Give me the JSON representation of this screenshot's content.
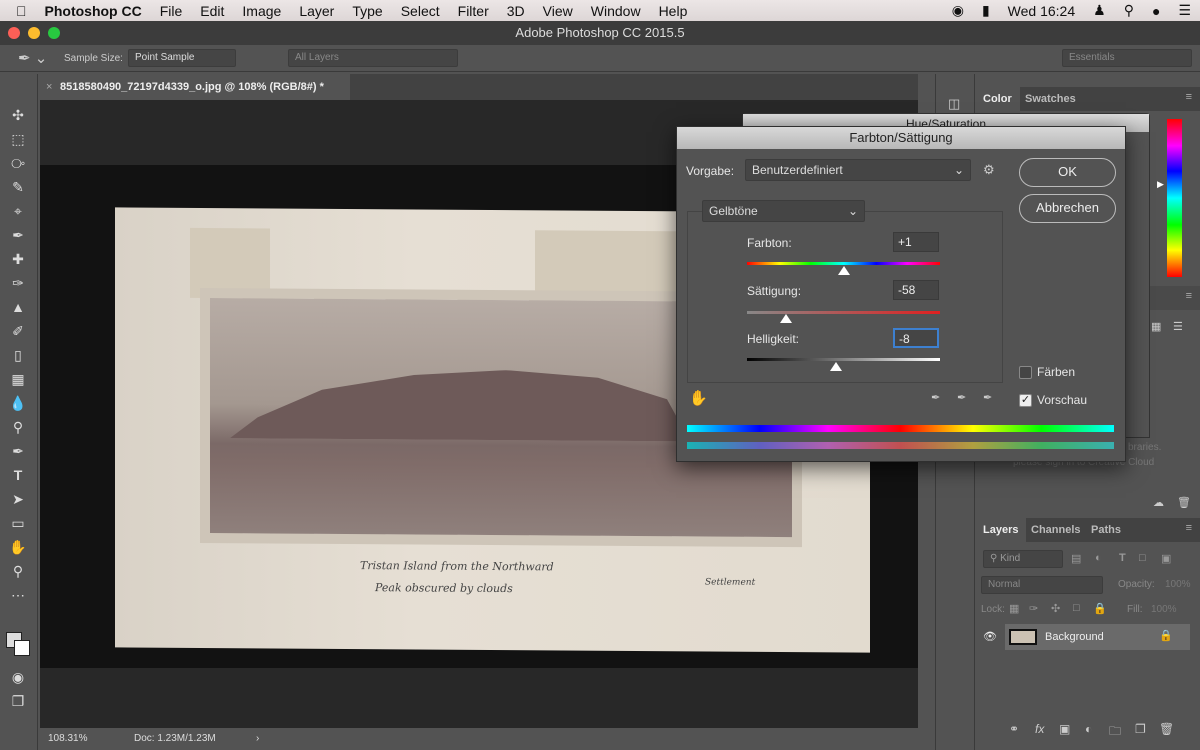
{
  "menubar": {
    "app": "Photoshop CC",
    "items": [
      "File",
      "Edit",
      "Image",
      "Layer",
      "Type",
      "Select",
      "Filter",
      "3D",
      "View",
      "Window",
      "Help"
    ],
    "clock": "Wed 16:24"
  },
  "window": {
    "title": "Adobe Photoshop CC 2015.5"
  },
  "options": {
    "sample_size_label": "Sample Size:",
    "sample_size_value": "Point Sample",
    "layers_value": "All Layers",
    "workspace": "Essentials"
  },
  "document": {
    "tab": "8518580490_72197d4339_o.jpg @ 108% (RGB/8#) *",
    "caption_line1": "Tristan Island from the Northward",
    "caption_line2": "Peak obscured by clouds",
    "caption_right": "Settlement"
  },
  "status": {
    "zoom": "108.31%",
    "doc": "Doc: 1.23M/1.23M"
  },
  "panels": {
    "color_tabs": [
      "Color",
      "Swatches"
    ],
    "libraries_text1": "braries.",
    "libraries_text2": "please sign in to Creative Cloud",
    "layers_tabs": [
      "Layers",
      "Channels",
      "Paths"
    ],
    "kind": "Kind",
    "blend": "Normal",
    "opacity_label": "Opacity:",
    "opacity": "100%",
    "lock_label": "Lock:",
    "fill_label": "Fill:",
    "fill": "100%",
    "layer_name": "Background"
  },
  "dialog_behind": {
    "title": "Hue/Saturation"
  },
  "dialog": {
    "title": "Farbton/Sättigung",
    "preset_label": "Vorgabe:",
    "preset_value": "Benutzerdefiniert",
    "channel": "Gelbtöne",
    "hue_label": "Farbton:",
    "hue": "+1",
    "sat_label": "Sättigung:",
    "sat": "-58",
    "light_label": "Helligkeit:",
    "light": "-8",
    "ok": "OK",
    "cancel": "Abbrechen",
    "colorize_label": "Färben",
    "colorize": false,
    "preview_label": "Vorschau",
    "preview": true
  }
}
